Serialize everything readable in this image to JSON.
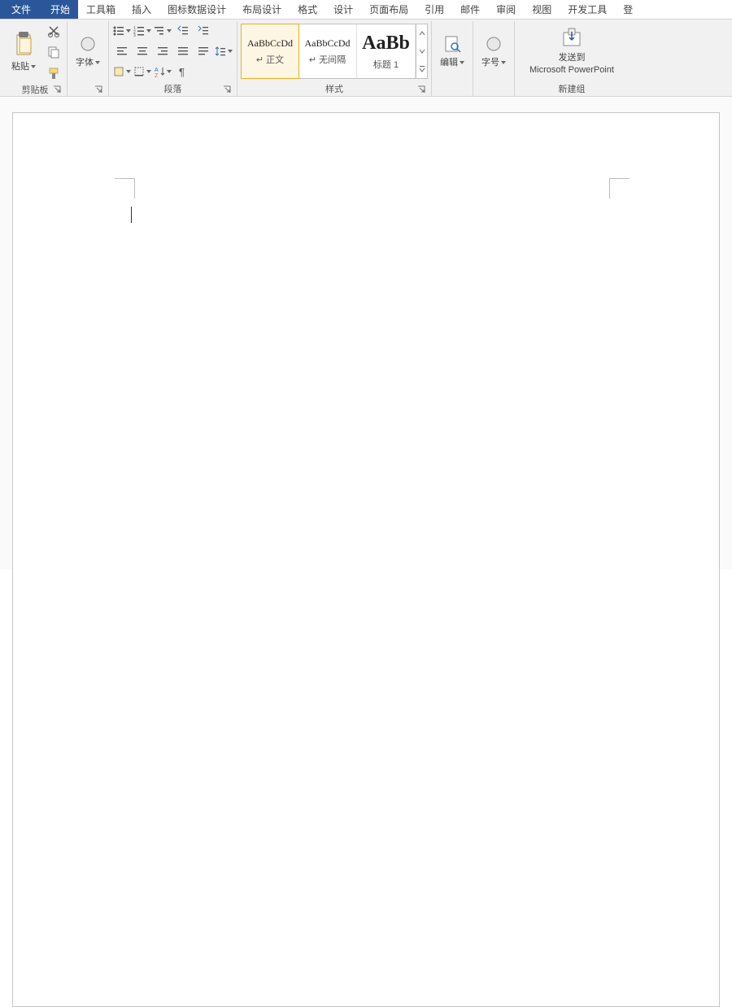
{
  "tabs": {
    "file": "文件",
    "home": "开始",
    "toolbox": "工具箱",
    "insert": "插入",
    "chartdata": "图标数据设计",
    "layout": "布局设计",
    "format": "格式",
    "design": "设计",
    "pagelayout": "页面布局",
    "reference": "引用",
    "mail": "邮件",
    "review": "审阅",
    "view": "视图",
    "dev": "开发工具",
    "login": "登"
  },
  "groups": {
    "clipboard": "剪贴板",
    "font": "字体",
    "paragraph": "段落",
    "styles": "样式",
    "edit": "编辑",
    "size": "字号",
    "newgroup": "新建组"
  },
  "buttons": {
    "paste": "粘贴",
    "font": "字体",
    "edit": "编辑",
    "size": "字号",
    "sendto": "发送到",
    "sendto2": "Microsoft PowerPoint"
  },
  "styles": {
    "s1": {
      "prev": "AaBbCcDd",
      "lbl": "↵ 正文"
    },
    "s2": {
      "prev": "AaBbCcDd",
      "lbl": "↵ 无间隔"
    },
    "s3": {
      "prev": "AaBb",
      "lbl": "标题 1"
    }
  }
}
